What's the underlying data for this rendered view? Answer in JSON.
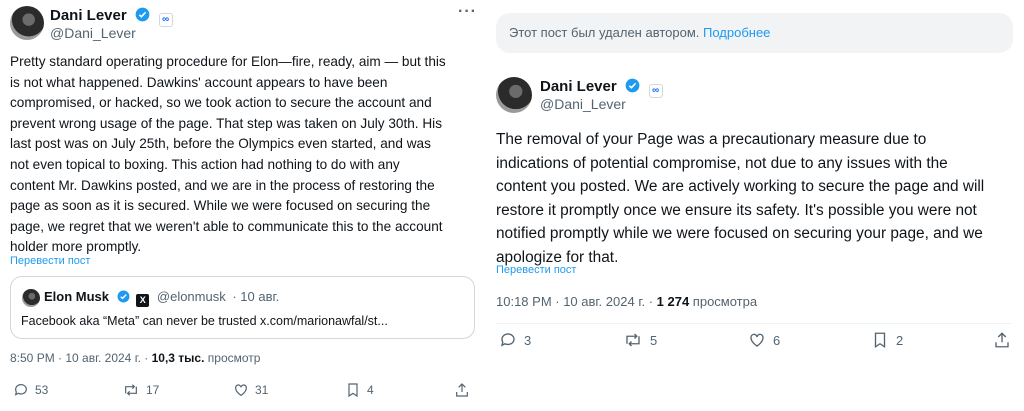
{
  "left_post": {
    "author_name": "Dani Lever",
    "author_handle": "@Dani_Lever",
    "more_label": "···",
    "text": "Pretty standard operating procedure for Elon—fire, ready, aim — but this\nis not what happened. Dawkins' account appears to have been\ncompromised, or hacked, so we took action to secure the account and\nprevent wrong usage of the page. That step was taken on July 30th. His\nlast post was on July 25th, before the Olympics even started, and was\nnot even topical to boxing. This action had nothing to do with any\ncontent Mr. Dawkins posted, and we are in the process of restoring the\npage as soon as it is secured. While we were focused on securing the\npage, we regret that we weren't able to communicate this to the account\nholder more promptly.",
    "translate_label": "Перевести пост",
    "quote": {
      "author_name": "Elon Musk",
      "author_handle": "@elonmusk",
      "date": "· 10 авг.",
      "text": "Facebook aka “Meta” can never be trusted x.com/marionawfal/st..."
    },
    "timestamp": "8:50 PM · 10 авг. 2024 г. · ",
    "views_count": "10,3 тыс.",
    "views_label": " просмотр",
    "actions": {
      "replies": "53",
      "reposts": "17",
      "likes": "31",
      "bookmarks": "4"
    }
  },
  "right_post": {
    "deleted_notice": "Этот пост был удален автором. ",
    "deleted_link": "Подробнее",
    "author_name": "Dani Lever",
    "author_handle": "@Dani_Lever",
    "text": "The removal of your Page was a precautionary measure due to\nindications of potential compromise, not due to any issues with the\ncontent you posted. We are actively working to secure the page and will\nrestore it promptly once we ensure its safety. It's possible you were not\nnotified promptly while we were focused on securing your page, and we\napologize for that.",
    "translate_label": "Перевести пост",
    "timestamp": "10:18 PM · 10 авг. 2024 г. · ",
    "views_count": "1 274",
    "views_label": " просмотра",
    "actions": {
      "replies": "3",
      "reposts": "5",
      "likes": "6",
      "bookmarks": "2"
    }
  },
  "colors": {
    "accent": "#1d9bf0",
    "text": "#0f1419",
    "muted": "#536471",
    "border": "#cfd9de"
  },
  "icons": [
    "verified-badge-icon",
    "meta-badge-icon",
    "x-badge-icon",
    "reply-icon",
    "repost-icon",
    "like-icon",
    "bookmark-icon",
    "share-icon",
    "more-icon"
  ]
}
